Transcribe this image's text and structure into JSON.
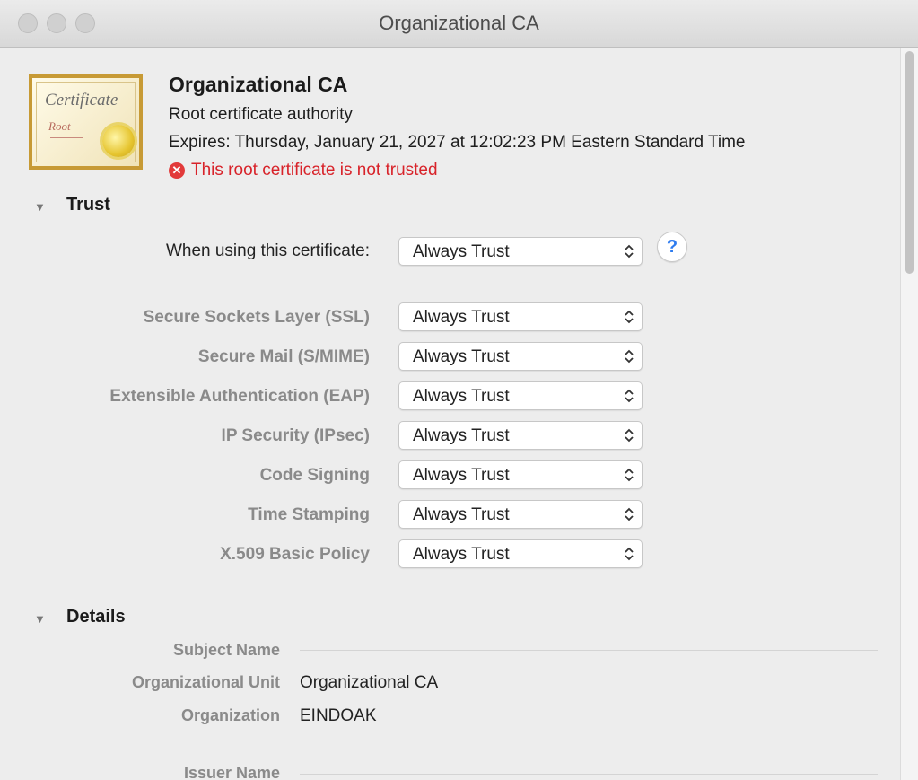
{
  "window": {
    "title": "Organizational CA"
  },
  "header": {
    "cert_image": {
      "line1": "Certificate",
      "line2": "Root"
    },
    "title": "Organizational CA",
    "subtitle": "Root certificate authority",
    "expires": "Expires: Thursday, January 21, 2027 at 12:02:23 PM Eastern Standard Time",
    "warning": "This root certificate is not trusted",
    "warning_color": "#d8232a"
  },
  "trust": {
    "section_title": "Trust",
    "main": {
      "label": "When using this certificate:",
      "value": "Always Trust"
    },
    "help_label": "?",
    "policies": [
      {
        "label": "Secure Sockets Layer (SSL)",
        "value": "Always Trust"
      },
      {
        "label": "Secure Mail (S/MIME)",
        "value": "Always Trust"
      },
      {
        "label": "Extensible Authentication (EAP)",
        "value": "Always Trust"
      },
      {
        "label": "IP Security (IPsec)",
        "value": "Always Trust"
      },
      {
        "label": "Code Signing",
        "value": "Always Trust"
      },
      {
        "label": "Time Stamping",
        "value": "Always Trust"
      },
      {
        "label": "X.509 Basic Policy",
        "value": "Always Trust"
      }
    ]
  },
  "details": {
    "section_title": "Details",
    "subject_header": "Subject Name",
    "subject_fields": [
      {
        "label": "Organizational Unit",
        "value": "Organizational CA"
      },
      {
        "label": "Organization",
        "value": "EINDOAK"
      }
    ],
    "issuer_header": "Issuer Name"
  }
}
